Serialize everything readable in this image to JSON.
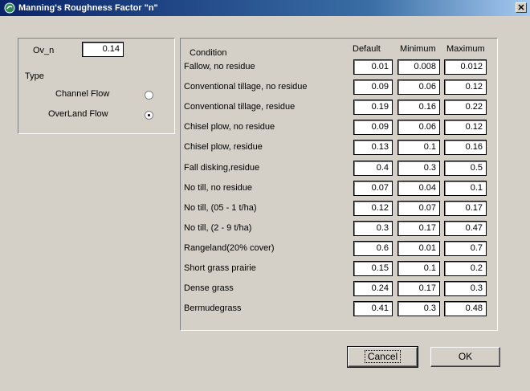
{
  "window": {
    "title": "Manning's Roughness Factor \"n\""
  },
  "ov_n": {
    "label": "Ov_n",
    "value": "0.14"
  },
  "type_group": {
    "label": "Type",
    "options": [
      {
        "label": "Channel Flow",
        "selected": false
      },
      {
        "label": "OverLand Flow",
        "selected": true
      }
    ]
  },
  "table": {
    "headers": {
      "condition": "Condition",
      "default": "Default",
      "minimum": "Minimum",
      "maximum": "Maximum"
    },
    "rows": [
      {
        "condition": "Fallow, no residue",
        "default": "0.01",
        "minimum": "0.008",
        "maximum": "0.012"
      },
      {
        "condition": "Conventional tillage, no residue",
        "default": "0.09",
        "minimum": "0.06",
        "maximum": "0.12"
      },
      {
        "condition": "Conventional tillage, residue",
        "default": "0.19",
        "minimum": "0.16",
        "maximum": "0.22"
      },
      {
        "condition": "Chisel plow, no residue",
        "default": "0.09",
        "minimum": "0.06",
        "maximum": "0.12"
      },
      {
        "condition": "Chisel plow, residue",
        "default": "0.13",
        "minimum": "0.1",
        "maximum": "0.16"
      },
      {
        "condition": "Fall disking,residue",
        "default": "0.4",
        "minimum": "0.3",
        "maximum": "0.5"
      },
      {
        "condition": "No till, no residue",
        "default": "0.07",
        "minimum": "0.04",
        "maximum": "0.1"
      },
      {
        "condition": "No till, (05 - 1 t/ha)",
        "default": "0.12",
        "minimum": "0.07",
        "maximum": "0.17"
      },
      {
        "condition": "No till, (2 - 9 t/ha)",
        "default": "0.3",
        "minimum": "0.17",
        "maximum": "0.47"
      },
      {
        "condition": "Rangeland(20% cover)",
        "default": "0.6",
        "minimum": "0.01",
        "maximum": "0.7"
      },
      {
        "condition": "Short grass prairie",
        "default": "0.15",
        "minimum": "0.1",
        "maximum": "0.2"
      },
      {
        "condition": "Dense grass",
        "default": "0.24",
        "minimum": "0.17",
        "maximum": "0.3"
      },
      {
        "condition": "Bermudegrass",
        "default": "0.41",
        "minimum": "0.3",
        "maximum": "0.48"
      }
    ]
  },
  "buttons": {
    "cancel": "Cancel",
    "ok": "OK"
  }
}
